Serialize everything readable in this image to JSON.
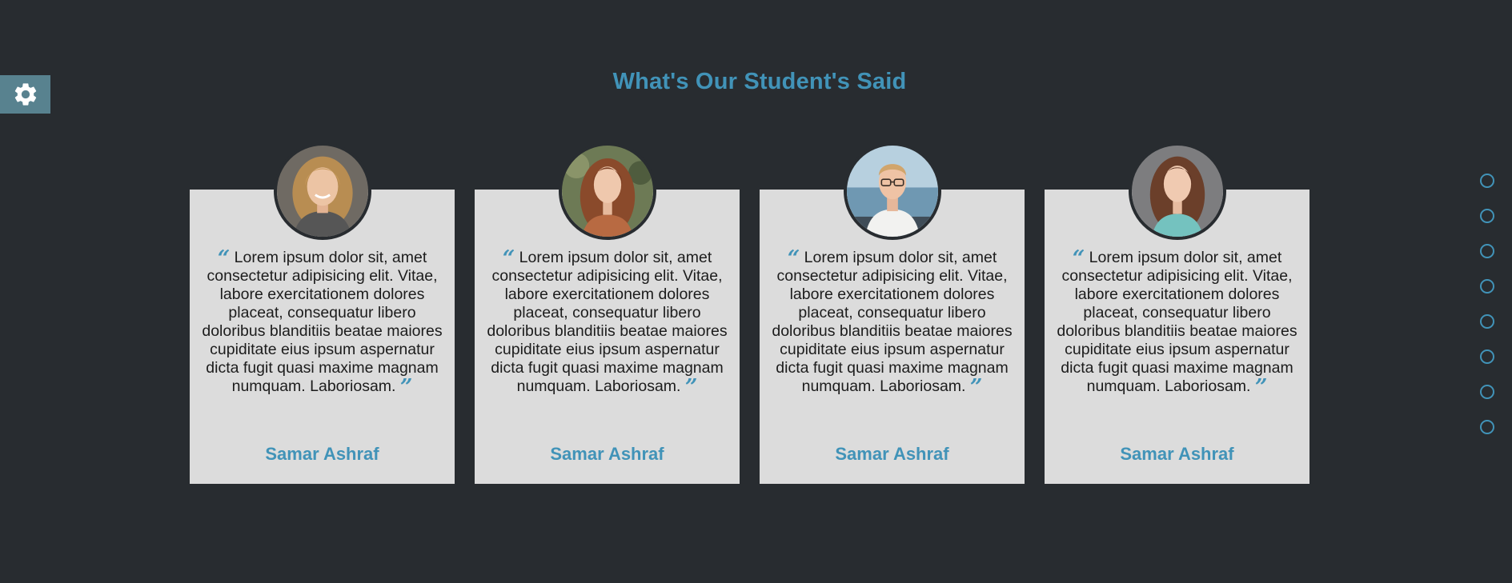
{
  "settings": {
    "icon": "gear-icon",
    "bg_color": "#58828f"
  },
  "section": {
    "title": "What's Our Student's Said",
    "accent_color": "#4193b8",
    "background_color": "#282c30"
  },
  "testimonials": [
    {
      "avatar": "avatar-blonde-woman",
      "open_quote": "“",
      "text": "Lorem ipsum dolor sit, amet consectetur adipisicing elit. Vitae, labore exercitationem dolores placeat, consequatur libero doloribus blanditiis beatae maiores cupiditate eius ipsum aspernatur dicta fugit quasi maxime magnam numquam. Laboriosam.",
      "close_quote": "”",
      "name": "Samar Ashraf"
    },
    {
      "avatar": "avatar-auburn-woman",
      "open_quote": "“",
      "text": "Lorem ipsum dolor sit, amet consectetur adipisicing elit. Vitae, labore exercitationem dolores placeat, consequatur libero doloribus blanditiis beatae maiores cupiditate eius ipsum aspernatur dicta fugit quasi maxime magnam numquam. Laboriosam.",
      "close_quote": "”",
      "name": "Samar Ashraf"
    },
    {
      "avatar": "avatar-young-man-glasses",
      "open_quote": "“",
      "text": "Lorem ipsum dolor sit, amet consectetur adipisicing elit. Vitae, labore exercitationem dolores placeat, consequatur libero doloribus blanditiis beatae maiores cupiditate eius ipsum aspernatur dicta fugit quasi maxime magnam numquam. Laboriosam.",
      "close_quote": "”",
      "name": "Samar Ashraf"
    },
    {
      "avatar": "avatar-brunette-woman",
      "open_quote": "“",
      "text": "Lorem ipsum dolor sit, amet consectetur adipisicing elit. Vitae, labore exercitationem dolores placeat, consequatur libero doloribus blanditiis beatae maiores cupiditate eius ipsum aspernatur dicta fugit quasi maxime magnam numquam. Laboriosam.",
      "close_quote": "”",
      "name": "Samar Ashraf"
    }
  ],
  "nav_bullets": {
    "count": 8,
    "active_index": null
  }
}
